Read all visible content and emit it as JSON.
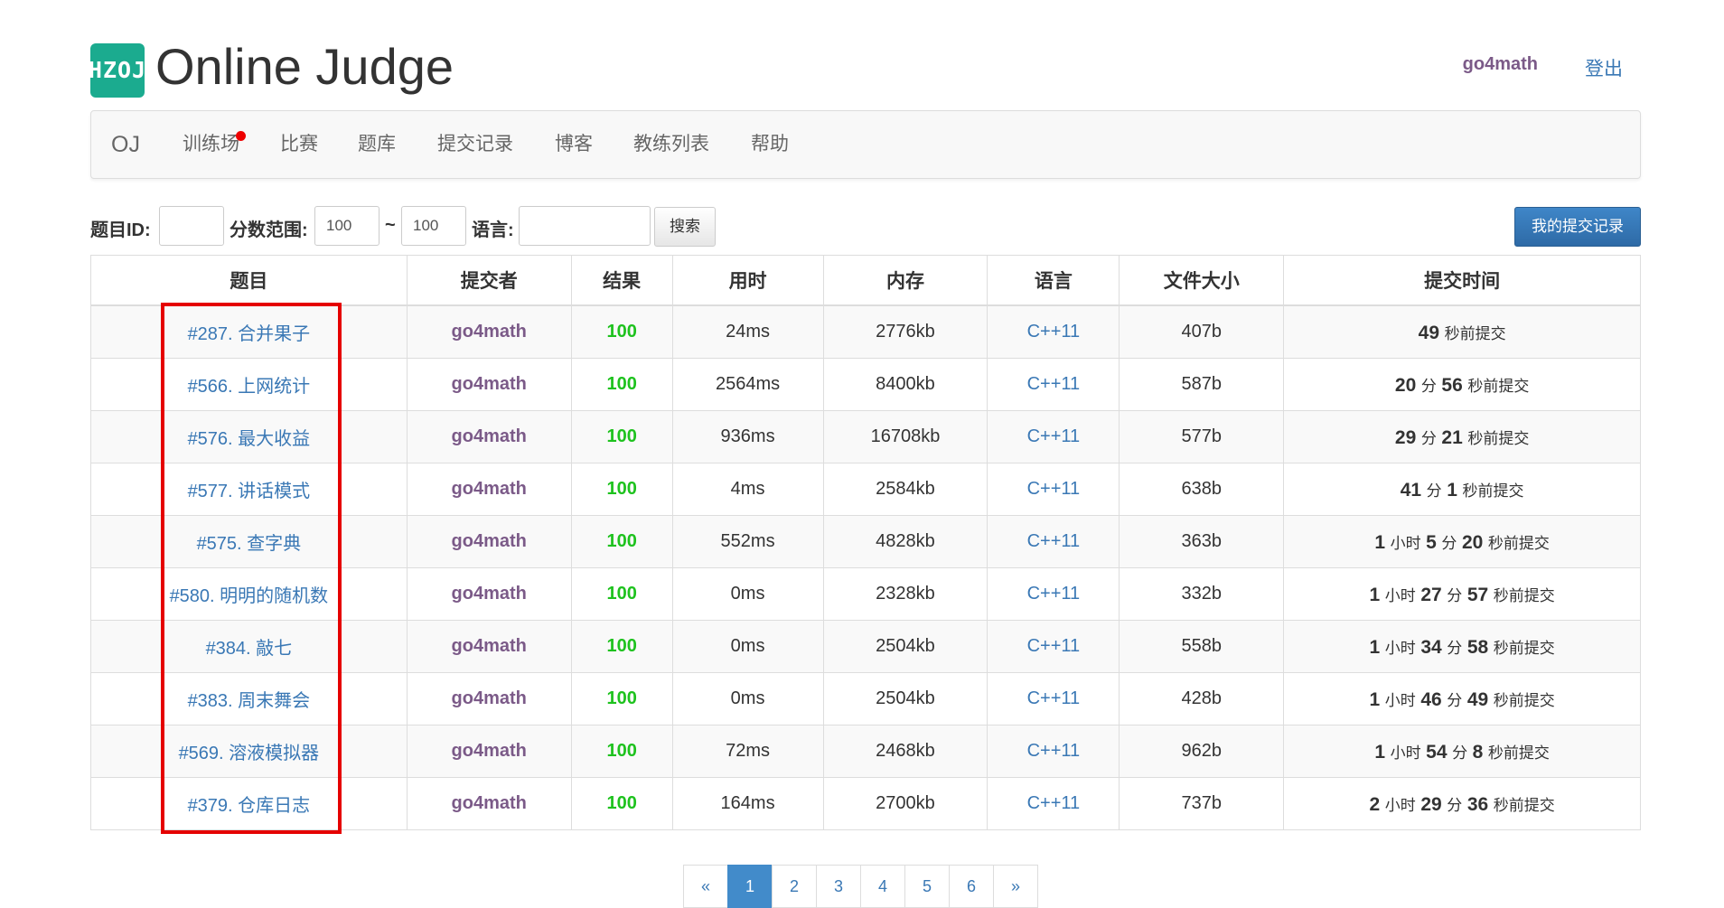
{
  "header": {
    "logo_text": "HZOJ",
    "title": "Online Judge",
    "username": "go4math",
    "logout": "登出"
  },
  "nav": {
    "brand": "OJ",
    "items": [
      "训练场",
      "比赛",
      "题库",
      "提交记录",
      "博客",
      "教练列表",
      "帮助"
    ],
    "notification_dot_color": "#e00000"
  },
  "filter": {
    "problem_id_label": "题目ID:",
    "problem_id_value": "",
    "score_label": "分数范围:",
    "score_min": "100",
    "tilde": "~",
    "score_max": "100",
    "lang_label": "语言:",
    "lang_value": "",
    "search_button": "搜索",
    "my_submissions_button": "我的提交记录"
  },
  "table": {
    "columns": [
      "题目",
      "提交者",
      "结果",
      "用时",
      "内存",
      "语言",
      "文件大小",
      "提交时间"
    ],
    "rows": [
      {
        "problem": "#287. 合并果子",
        "submitter": "go4math",
        "result": "100",
        "time": "24ms",
        "memory": "2776kb",
        "lang": "C++11",
        "size": "407b",
        "submit_time": [
          [
            "49",
            "秒前提交"
          ]
        ]
      },
      {
        "problem": "#566. 上网统计",
        "submitter": "go4math",
        "result": "100",
        "time": "2564ms",
        "memory": "8400kb",
        "lang": "C++11",
        "size": "587b",
        "submit_time": [
          [
            "20",
            "分"
          ],
          [
            "56",
            "秒前提交"
          ]
        ]
      },
      {
        "problem": "#576. 最大收益",
        "submitter": "go4math",
        "result": "100",
        "time": "936ms",
        "memory": "16708kb",
        "lang": "C++11",
        "size": "577b",
        "submit_time": [
          [
            "29",
            "分"
          ],
          [
            "21",
            "秒前提交"
          ]
        ]
      },
      {
        "problem": "#577. 讲话模式",
        "submitter": "go4math",
        "result": "100",
        "time": "4ms",
        "memory": "2584kb",
        "lang": "C++11",
        "size": "638b",
        "submit_time": [
          [
            "41",
            "分"
          ],
          [
            "1",
            "秒前提交"
          ]
        ]
      },
      {
        "problem": "#575. 查字典",
        "submitter": "go4math",
        "result": "100",
        "time": "552ms",
        "memory": "4828kb",
        "lang": "C++11",
        "size": "363b",
        "submit_time": [
          [
            "1",
            "小时"
          ],
          [
            "5",
            "分"
          ],
          [
            "20",
            "秒前提交"
          ]
        ]
      },
      {
        "problem": "#580. 明明的随机数",
        "submitter": "go4math",
        "result": "100",
        "time": "0ms",
        "memory": "2328kb",
        "lang": "C++11",
        "size": "332b",
        "submit_time": [
          [
            "1",
            "小时"
          ],
          [
            "27",
            "分"
          ],
          [
            "57",
            "秒前提交"
          ]
        ]
      },
      {
        "problem": "#384. 敲七",
        "submitter": "go4math",
        "result": "100",
        "time": "0ms",
        "memory": "2504kb",
        "lang": "C++11",
        "size": "558b",
        "submit_time": [
          [
            "1",
            "小时"
          ],
          [
            "34",
            "分"
          ],
          [
            "58",
            "秒前提交"
          ]
        ]
      },
      {
        "problem": "#383. 周末舞会",
        "submitter": "go4math",
        "result": "100",
        "time": "0ms",
        "memory": "2504kb",
        "lang": "C++11",
        "size": "428b",
        "submit_time": [
          [
            "1",
            "小时"
          ],
          [
            "46",
            "分"
          ],
          [
            "49",
            "秒前提交"
          ]
        ]
      },
      {
        "problem": "#569. 溶液模拟器",
        "submitter": "go4math",
        "result": "100",
        "time": "72ms",
        "memory": "2468kb",
        "lang": "C++11",
        "size": "962b",
        "submit_time": [
          [
            "1",
            "小时"
          ],
          [
            "54",
            "分"
          ],
          [
            "8",
            "秒前提交"
          ]
        ]
      },
      {
        "problem": "#379. 仓库日志",
        "submitter": "go4math",
        "result": "100",
        "time": "164ms",
        "memory": "2700kb",
        "lang": "C++11",
        "size": "737b",
        "submit_time": [
          [
            "2",
            "小时"
          ],
          [
            "29",
            "分"
          ],
          [
            "36",
            "秒前提交"
          ]
        ]
      }
    ]
  },
  "pagination": {
    "first": "«",
    "pages": [
      "1",
      "2",
      "3",
      "4",
      "5",
      "6"
    ],
    "active": "1",
    "next": "»"
  },
  "colors": {
    "brand_green": "#1bab8f",
    "link_blue": "#3a78b5",
    "user_purple": "#7b5a88",
    "score_green": "#1ec21e",
    "highlight_red": "#e50000"
  }
}
